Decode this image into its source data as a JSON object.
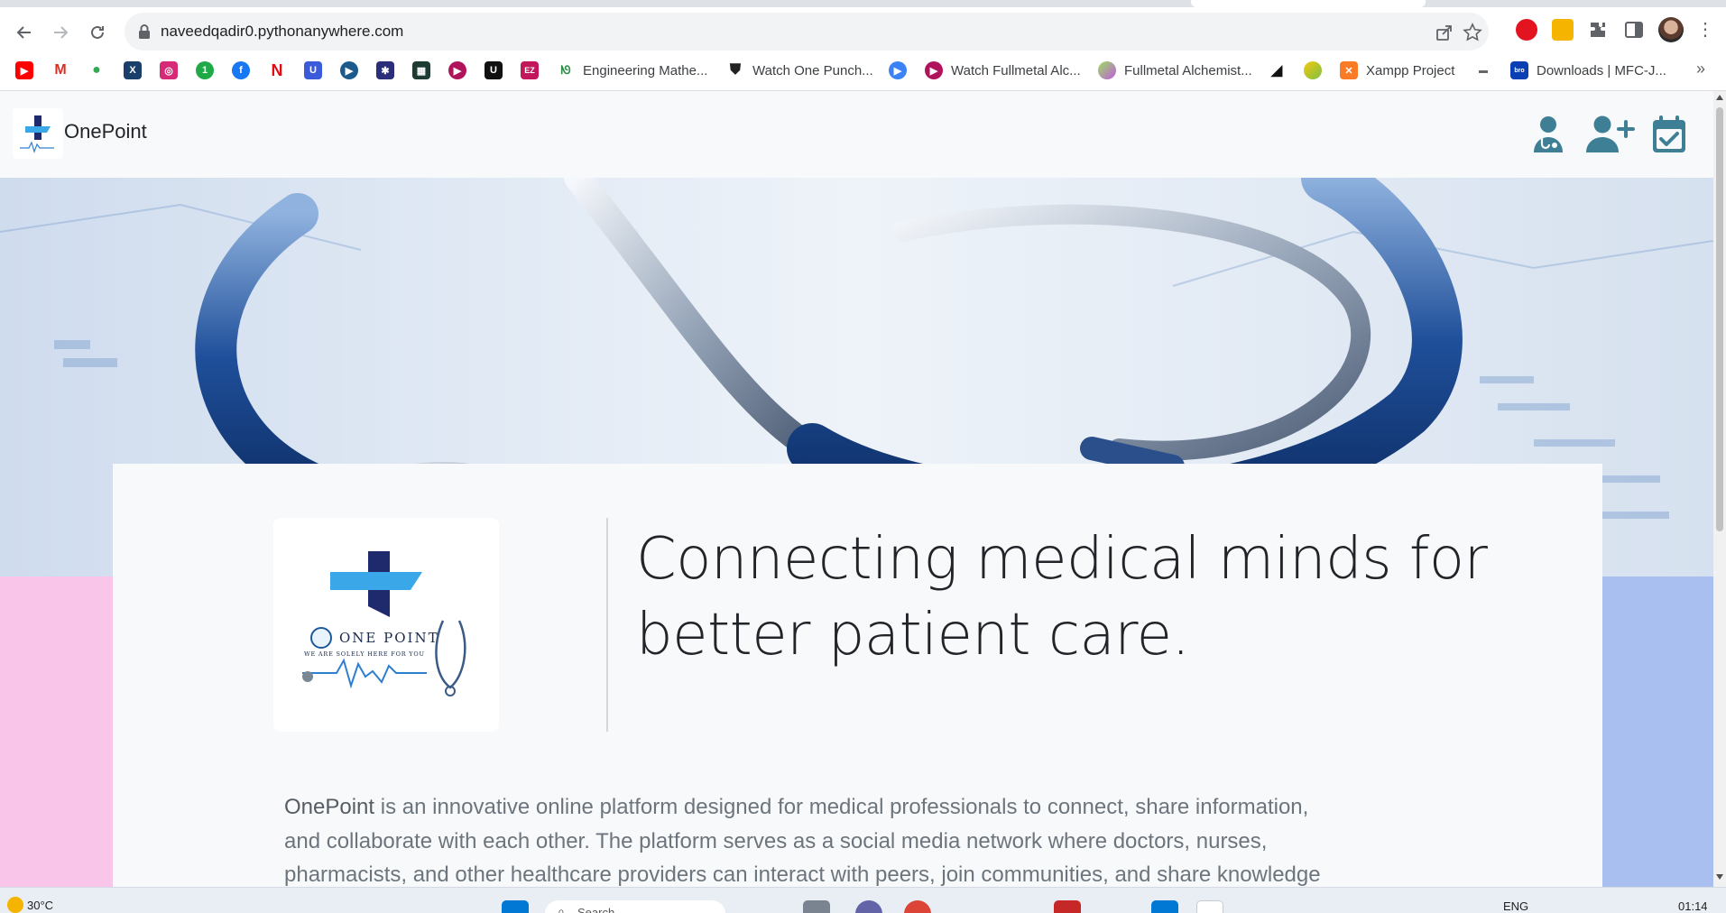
{
  "browser": {
    "url": "naveedqadir0.pythonanywhere.com",
    "bookmarks": [
      {
        "icon": "youtube-icon",
        "label": ""
      },
      {
        "icon": "gmail-icon",
        "label": ""
      },
      {
        "icon": "maps-icon",
        "label": ""
      },
      {
        "icon": "bookmark-icon",
        "label": ""
      },
      {
        "icon": "instagram-icon",
        "label": ""
      },
      {
        "icon": "bookmark-icon",
        "label": ""
      },
      {
        "icon": "facebook-icon",
        "label": ""
      },
      {
        "icon": "netflix-icon",
        "label": ""
      },
      {
        "icon": "bookmark-icon",
        "label": ""
      },
      {
        "icon": "play-icon",
        "label": ""
      },
      {
        "icon": "bookmark-icon",
        "label": ""
      },
      {
        "icon": "bookmark-icon",
        "label": ""
      },
      {
        "icon": "play-icon",
        "label": ""
      },
      {
        "icon": "bookmark-icon",
        "label": ""
      },
      {
        "icon": "bookmark-icon",
        "label": ""
      },
      {
        "icon": "geeksforgeeks-icon",
        "label": "Engineering Mathe..."
      },
      {
        "icon": "shield-icon",
        "label": "Watch One Punch..."
      },
      {
        "icon": "play-icon",
        "label": ""
      },
      {
        "icon": "play-icon",
        "label": "Watch Fullmetal Alc..."
      },
      {
        "icon": "bookmark-icon",
        "label": "Fullmetal Alchemist..."
      },
      {
        "icon": "bookmark-icon",
        "label": ""
      },
      {
        "icon": "bookmark-icon",
        "label": ""
      },
      {
        "icon": "xampp-icon",
        "label": "Xampp Project"
      },
      {
        "icon": "bookmark-icon",
        "label": ""
      },
      {
        "icon": "brother-icon",
        "label": "Downloads | MFC-J..."
      }
    ],
    "more_bookmarks": "»"
  },
  "navbar": {
    "brand": "OnePoint",
    "icons": [
      "doctor-icon",
      "add-user-icon",
      "calendar-check-icon"
    ]
  },
  "hero": {
    "headline": "Connecting medical minds for better patient care."
  },
  "logo": {
    "text": "ONE POINT",
    "tagline": "WE ARE SOLELY HERE FOR YOU"
  },
  "about": {
    "brand": "OnePoint",
    "text": " is an innovative online platform designed for medical professionals to connect, share information, and collaborate with each other. The platform serves as a social media network where doctors, nurses, pharmacists, and other healthcare providers can interact with peers, join communities, and share knowledge"
  },
  "taskbar": {
    "weather": "30°C",
    "search_placeholder": "Search",
    "language": "ENG",
    "time": "01:14"
  },
  "colors": {
    "side_pink": "#f9c5e8",
    "side_blue": "#a9bff0",
    "icon_teal": "#3f7f95"
  }
}
